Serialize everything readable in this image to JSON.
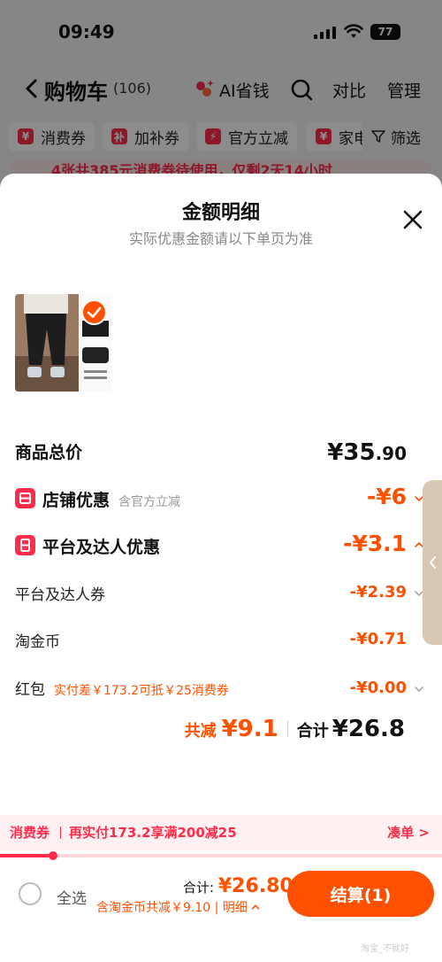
{
  "status_bar": {
    "time": "09:49",
    "battery": "77"
  },
  "cart_header": {
    "title": "购物车",
    "count": "(106)",
    "ai_label": "AI省钱",
    "compare": "对比",
    "manage": "管理"
  },
  "filters": {
    "chips": [
      {
        "icon": "¥",
        "label": "消费券"
      },
      {
        "icon": "补",
        "label": "加补券"
      },
      {
        "icon": "⚡",
        "label": "官方立减"
      },
      {
        "icon": "¥",
        "label": "家电"
      }
    ],
    "filter_label": "筛选",
    "notice": "4张共385元消费券待使用，仅剩2天14小时"
  },
  "sheet": {
    "title": "金额明细",
    "subtitle": "实际优惠金额请以下单页为准",
    "product_price_label": "商品总价",
    "product_price_yen": "¥35",
    "product_price_dec": ".90",
    "shop_discount_label": "店铺优惠",
    "shop_discount_note": "含官方立减",
    "shop_discount_value": "-¥6",
    "platform_discount_label": "平台及达人优惠",
    "platform_discount_value": "-¥3.1",
    "platform_coupon_label": "平台及达人券",
    "platform_coupon_value": "-¥2.39",
    "taojinbi_label": "淘金币",
    "taojinbi_value": "-¥0.71",
    "hongbao_label": "红包",
    "hongbao_note": "实付差￥173.2可抵￥25消费券",
    "hongbao_value": "-¥0.00",
    "summary_save_label": "共减",
    "summary_save_value": "¥9.1",
    "summary_total_label": "合计",
    "summary_total_value": "¥26.8"
  },
  "coupon_bar": {
    "tag": "消费券",
    "message": "再实付173.2享满200减25",
    "link": "凑单 >",
    "progress": 0.12
  },
  "bottom_bar": {
    "select_all": "全选",
    "total_label": "合计:",
    "total_value": "¥26.80",
    "savings": "含淘金币共减￥9.10 | 明细",
    "checkout": "结算(1)"
  },
  "watermark": "淘宝_不就好",
  "colors": {
    "accent": "#ff5000",
    "red": "#ff2d4b"
  }
}
